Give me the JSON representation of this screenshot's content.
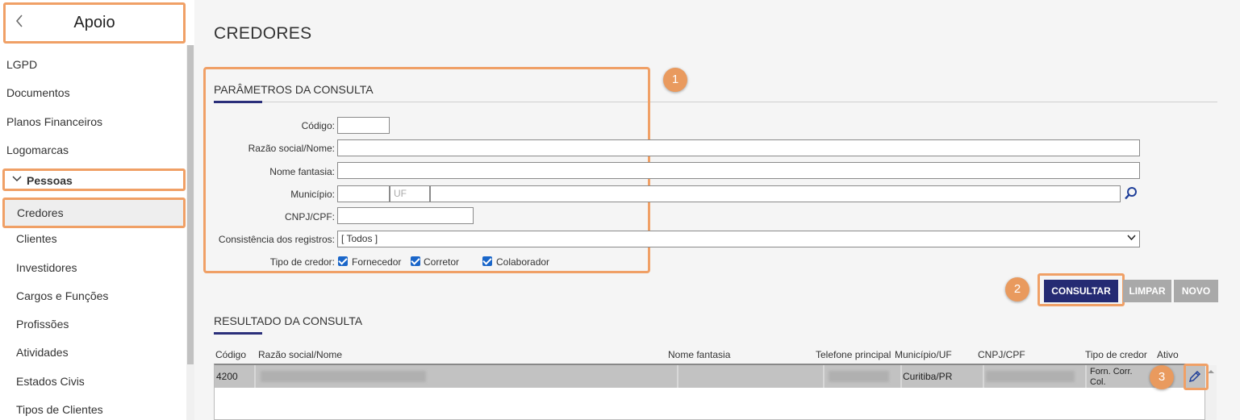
{
  "sidebar": {
    "title": "Apoio",
    "items_top": [
      "LGPD",
      "Documentos",
      "Planos Financeiros",
      "Logomarcas"
    ],
    "group_label": "Pessoas",
    "active_item": "Credores",
    "sub_items": [
      "Clientes",
      "Investidores",
      "Cargos e Funções",
      "Profissões",
      "Atividades",
      "Estados Civis",
      "Tipos de Clientes"
    ]
  },
  "page": {
    "title": "CREDORES",
    "params_title": "PARÂMETROS DA CONSULTA",
    "results_title": "RESULTADO DA CONSULTA"
  },
  "form": {
    "codigo_label": "Código:",
    "codigo_value": "",
    "razao_label": "Razão social/Nome:",
    "razao_value": "",
    "fantasia_label": "Nome fantasia:",
    "fantasia_value": "",
    "municipio_label": "Município:",
    "municipio_code": "",
    "uf_placeholder": "UF",
    "municipio_name": "",
    "cnpj_label": "CNPJ/CPF:",
    "cnpj_value": "",
    "consistencia_label": "Consistência dos registros:",
    "consistencia_value": "[ Todos ]",
    "tipo_label": "Tipo de credor:",
    "checkboxes": [
      {
        "label": "Fornecedor",
        "checked": true
      },
      {
        "label": "Corretor",
        "checked": true
      },
      {
        "label": "Colaborador",
        "checked": true
      }
    ]
  },
  "buttons": {
    "consultar": "CONSULTAR",
    "limpar": "LIMPAR",
    "novo": "NOVO"
  },
  "badges": [
    "1",
    "2",
    "3"
  ],
  "table": {
    "headers": [
      "Código",
      "Razão social/Nome",
      "Nome fantasia",
      "Telefone principal",
      "Município/UF",
      "CNPJ/CPF",
      "Tipo de credor",
      "Ativo"
    ],
    "rows": [
      {
        "codigo": "4200",
        "razao": "",
        "fantasia": "",
        "telefone": "",
        "municipio": "Curitiba/PR",
        "cnpj": "",
        "tipo_line1": "Forn. Corr.",
        "tipo_line2": "Col.",
        "ativo": ""
      }
    ]
  },
  "colors": {
    "highlight": "#f0a066",
    "primary": "#252b73",
    "accent_line": "#2a2f7a",
    "badge": "#e99a5e",
    "checkbox": "#1a66c9"
  },
  "icons": [
    "chevron-left-icon",
    "chevron-down-icon",
    "search-icon",
    "edit-pencil-icon",
    "checkbox-checked-icon"
  ]
}
